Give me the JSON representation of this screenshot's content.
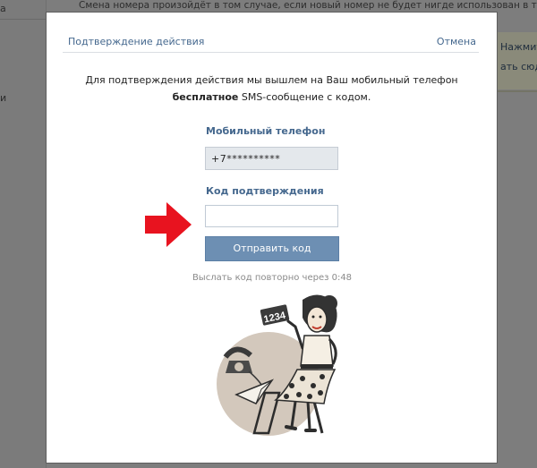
{
  "background": {
    "top_text": "Смена номера произойдёт в том случае, если новый номер не будет нигде использован в течение всег",
    "left_items": [
      "а",
      "и"
    ],
    "right_links": [
      "Нажмите",
      "ать сюд"
    ]
  },
  "modal": {
    "title": "Подтверждение действия",
    "cancel_label": "Отмена",
    "intro_line1": "Для подтверждения действия мы вышлем на Ваш мобильный телефон",
    "intro_bold": "бесплатное",
    "intro_rest": " SMS-сообщение с кодом.",
    "phone_label": "Мобильный телефон",
    "phone_value": "+7**********",
    "code_label": "Код подтверждения",
    "code_value": "",
    "send_button": "Отправить код",
    "resend_text": "Выслать код повторно через 0:48",
    "illustration_sign": "1234"
  },
  "colors": {
    "accent": "#45688e",
    "button": "#6d8fb3",
    "arrow": "#e8131f"
  }
}
